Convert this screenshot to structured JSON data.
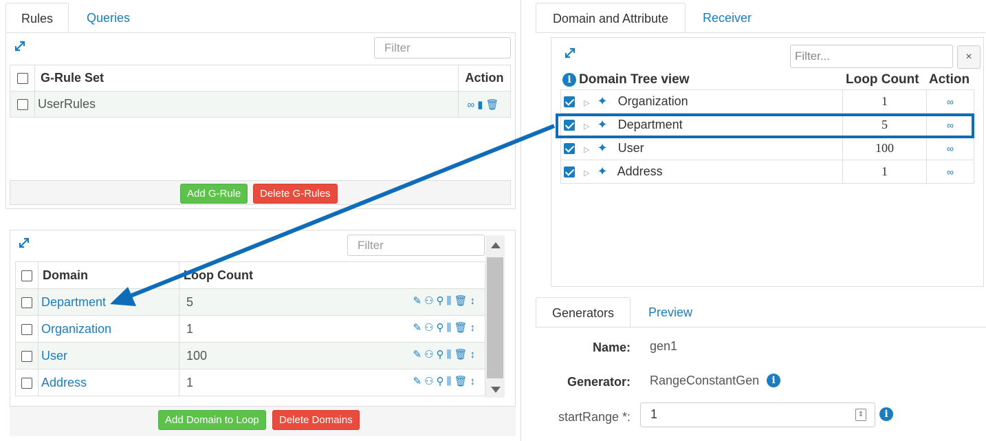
{
  "left_tabs": [
    "Rules",
    "Queries"
  ],
  "rules_panel": {
    "filter_placeholder": "Filter",
    "header": {
      "name": "G-Rule Set",
      "action": "Action"
    },
    "rows": [
      {
        "name": "UserRules"
      }
    ],
    "add_button": "Add G-Rule",
    "delete_button": "Delete G-Rules"
  },
  "domains_panel": {
    "filter_placeholder": "Filter",
    "header": {
      "domain": "Domain",
      "loop": "Loop Count"
    },
    "rows": [
      {
        "domain": "Department",
        "loop": "5"
      },
      {
        "domain": "Organization",
        "loop": "1"
      },
      {
        "domain": "User",
        "loop": "100"
      },
      {
        "domain": "Address",
        "loop": "1"
      }
    ],
    "add_button": "Add Domain to Loop",
    "delete_button": "Delete Domains"
  },
  "right_tabs": [
    "Domain and Attribute",
    "Receiver"
  ],
  "tree_panel": {
    "filter_placeholder": "Filter...",
    "clear_label": "×",
    "header": {
      "tree": "Domain Tree view",
      "loop": "Loop Count",
      "action": "Action"
    },
    "rows": [
      {
        "name": "Organization",
        "loop": "1",
        "checked": true
      },
      {
        "name": "Department",
        "loop": "5",
        "checked": true,
        "highlighted": true
      },
      {
        "name": "User",
        "loop": "100",
        "checked": true
      },
      {
        "name": "Address",
        "loop": "1",
        "checked": true
      }
    ]
  },
  "bottom_tabs": [
    "Generators",
    "Preview"
  ],
  "generator": {
    "name_label": "Name:",
    "name_value": "gen1",
    "generator_label": "Generator:",
    "generator_value": "RangeConstantGen",
    "start_label": "startRange *:",
    "start_value": "1"
  },
  "colors": {
    "accent": "#1a7dc0",
    "highlight": "#0f6cb8",
    "green": "#5cc24a",
    "red": "#e74c3c"
  }
}
